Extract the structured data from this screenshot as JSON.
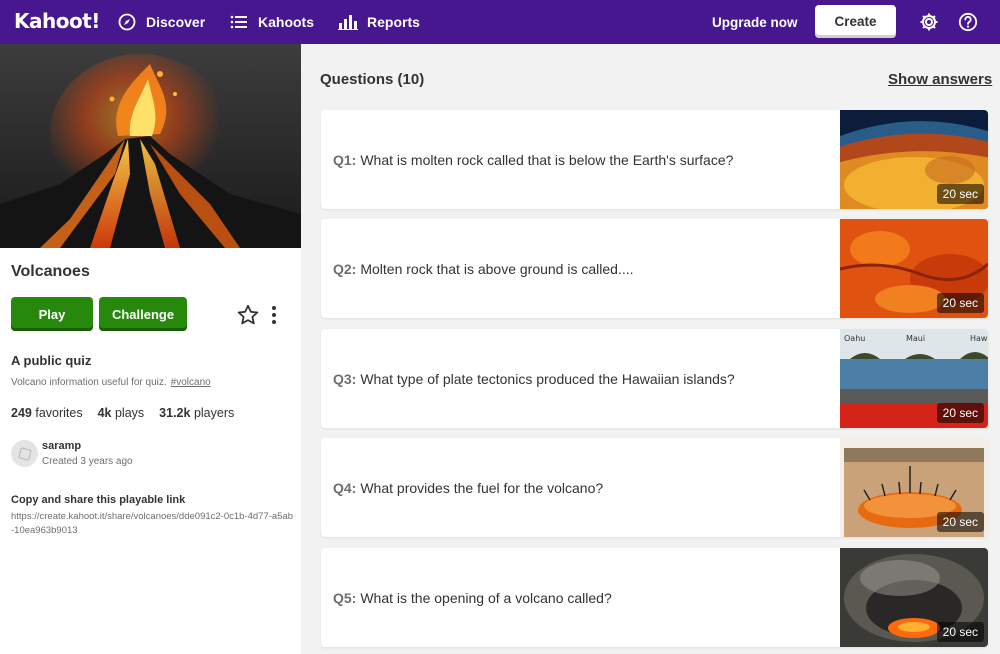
{
  "nav": {
    "logo": "Kahoot!",
    "items": [
      {
        "label": "Discover",
        "icon": "compass-icon"
      },
      {
        "label": "Kahoots",
        "icon": "list-icon"
      },
      {
        "label": "Reports",
        "icon": "bar-chart-icon"
      }
    ],
    "upgrade": "Upgrade now",
    "create": "Create",
    "icons": [
      "gear-icon",
      "help-icon"
    ]
  },
  "kahoot": {
    "title": "Volcanoes",
    "play": "Play",
    "challenge": "Challenge",
    "visibility": "A public quiz",
    "description": "Volcano information useful for quiz.",
    "tag": "#volcano",
    "stats": {
      "favorites_value": "249",
      "favorites_label": "favorites",
      "plays_value": "4k",
      "plays_label": "plays",
      "players_value": "31.2k",
      "players_label": "players"
    },
    "creator": "saramp",
    "created": "Created 3 years ago",
    "share_title": "Copy and share this playable link",
    "share_link": "https://create.kahoot.it/share/volcanoes/dde091c2-0c1b-4d77-a5ab-10ea963b9013"
  },
  "questions_header": "Questions (10)",
  "show_answers": "Show answers",
  "questions": [
    {
      "num": "Q1:",
      "text": "What is molten rock called that is below the Earth's surface?",
      "time": "20 sec"
    },
    {
      "num": "Q2:",
      "text": "Molten rock that is above ground is called....",
      "time": "20 sec"
    },
    {
      "num": "Q3:",
      "text": "What type of plate tectonics produced the Hawaiian islands?",
      "time": "20 sec",
      "thumb_labels": [
        "Oahu",
        "Maui",
        "Haw"
      ]
    },
    {
      "num": "Q4:",
      "text": "What provides the fuel for the volcano?",
      "time": "20 sec"
    },
    {
      "num": "Q5:",
      "text": "What is the opening of a volcano called?",
      "time": "20 sec"
    }
  ],
  "colors": {
    "brand": "#46178f",
    "green": "#26890c",
    "background": "#f2f2f2"
  }
}
